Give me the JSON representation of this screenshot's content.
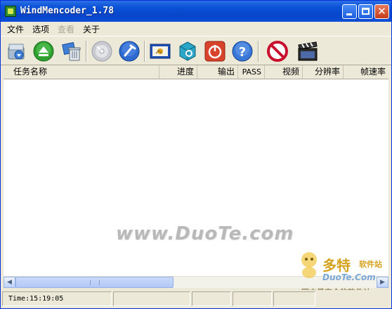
{
  "window": {
    "title": "WindMencoder_1.78"
  },
  "menu": [
    {
      "label": "文件",
      "enabled": true
    },
    {
      "label": "选项",
      "enabled": true
    },
    {
      "label": "查看",
      "enabled": false
    },
    {
      "label": "关于",
      "enabled": true
    }
  ],
  "toolbar": [
    {
      "icon": "add-file-icon"
    },
    {
      "icon": "eject-icon"
    },
    {
      "icon": "recycle-bin-icon"
    },
    {
      "icon": "disc-icon"
    },
    {
      "icon": "tools-icon"
    },
    {
      "icon": "preview-icon"
    },
    {
      "icon": "encode-icon"
    },
    {
      "icon": "power-icon"
    },
    {
      "icon": "help-icon"
    },
    {
      "icon": "stop-icon"
    },
    {
      "icon": "clapperboard-icon"
    }
  ],
  "columns": [
    "任务名称",
    "进度",
    "输出",
    "PASS",
    "视频",
    "分辨率",
    "帧速率"
  ],
  "watermark": {
    "text": "www.DuoTe.com"
  },
  "badge": {
    "brand": "多特",
    "sub": "软件站",
    "url": "DuoTe.Com",
    "slogan": "国内最安全的软件站"
  },
  "status": {
    "time": "Time:15:19:05"
  },
  "colors": {
    "titlebar": "#0a53d8",
    "stop": "#c8102e",
    "accent_green": "#2fa02f"
  }
}
